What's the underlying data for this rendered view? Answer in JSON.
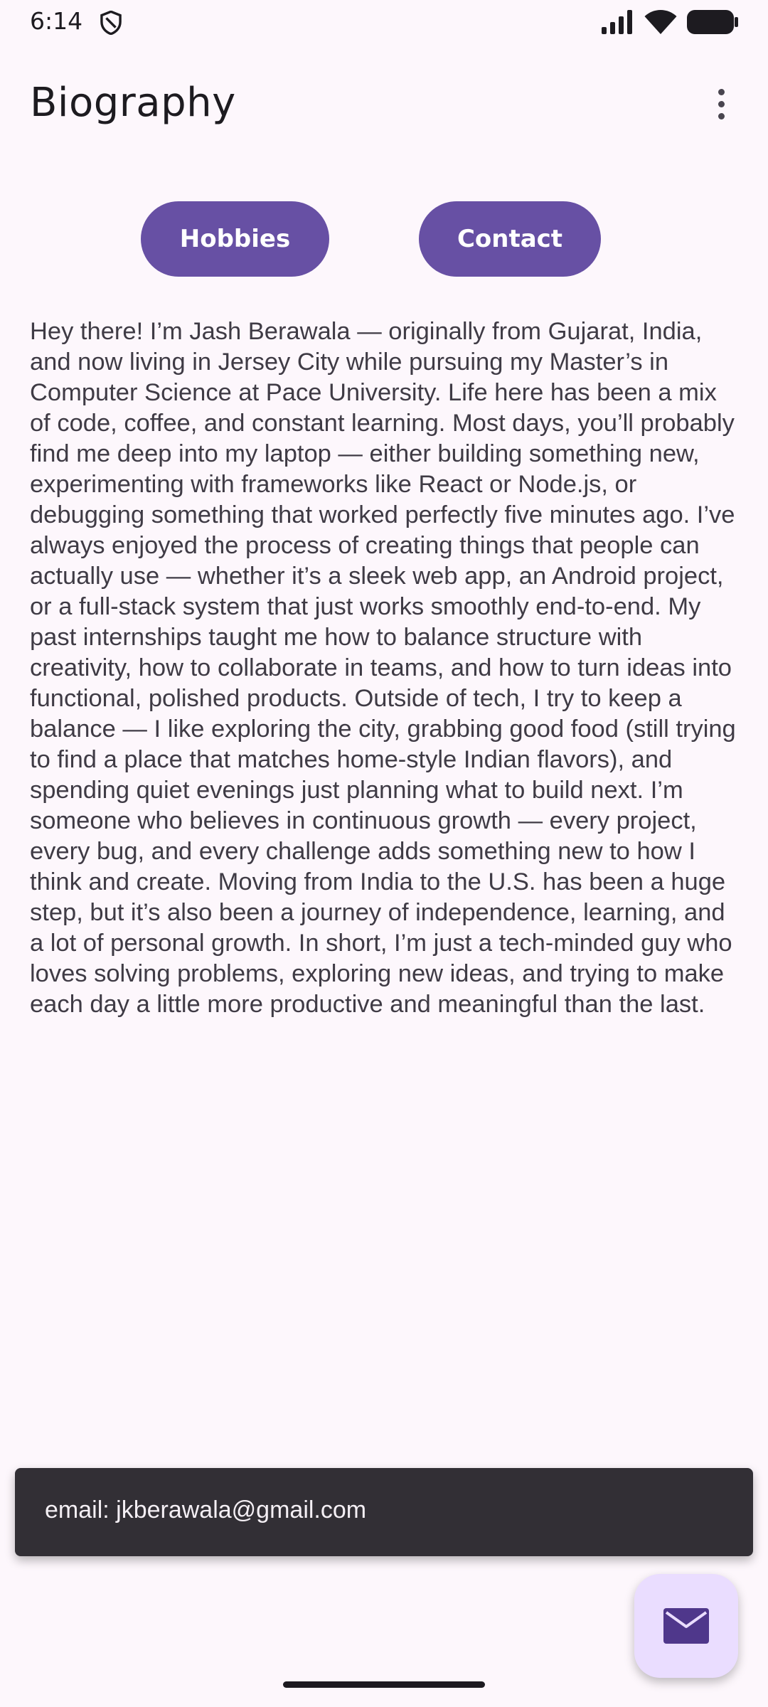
{
  "status_bar": {
    "time": "6:14",
    "icons": [
      "shield-icon",
      "signal-icon",
      "wifi-icon",
      "battery-icon"
    ]
  },
  "app_bar": {
    "title": "Biography",
    "menu_icon": "more-vert-icon"
  },
  "buttons": {
    "hobbies": "Hobbies",
    "contact": "Contact"
  },
  "bio": {
    "text": "Hey there! I’m Jash Berawala — originally from Gujarat, India, and now living in Jersey City while pursuing my Master’s in Computer Science at Pace University. Life here has been a mix of code, coffee, and constant learning. Most days, you’ll probably find me deep into my laptop — either building something new, experimenting with frameworks like React or Node.js, or debugging something that worked perfectly five minutes ago. I’ve always enjoyed the process of creating things that people can actually use — whether it’s a sleek web app, an Android project, or a full-stack system that just works smoothly end-to-end. My past internships taught me how to balance structure with creativity, how to collaborate in teams, and how to turn ideas into functional, polished products. Outside of tech, I try to keep a balance — I like exploring the city, grabbing good food (still trying to find a place that matches home-style Indian flavors), and spending quiet evenings just planning what to build next. I’m someone who believes in continuous growth — every project, every bug, and every challenge adds something new to how I think and create. Moving from India to the U.S. has been a huge step, but it’s also been a journey of independence, learning, and a lot of personal growth. In short, I’m just a tech-minded guy who loves solving problems, exploring new ideas, and trying to make each day a little more productive and meaningful than the last."
  },
  "snackbar": {
    "text": "email: jkberawala@gmail.com"
  },
  "fab": {
    "icon": "mail-icon"
  },
  "colors": {
    "background": "#FDF7FC",
    "primary": "#6750A4",
    "snackbar": "#322F35",
    "fab": "#EADDFF",
    "fab_icon": "#4F378B"
  }
}
